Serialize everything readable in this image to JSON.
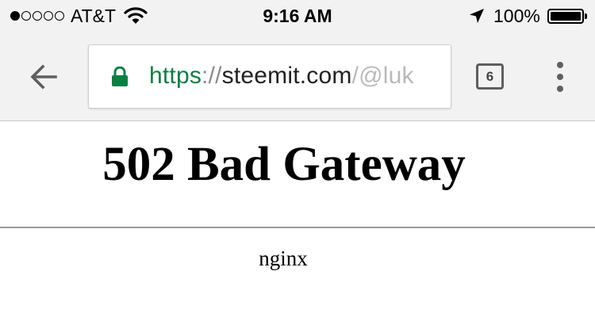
{
  "status_bar": {
    "signal_bars_filled": 1,
    "signal_bars_total": 5,
    "carrier": "AT&T",
    "time": "9:16 AM",
    "battery_percent": "100%",
    "battery_level": 1.0,
    "icons": [
      "wifi-icon",
      "location-arrow-icon",
      "battery-icon"
    ]
  },
  "browser": {
    "url": {
      "scheme": "https",
      "separator": "://",
      "host": "steemit.com",
      "path": "/@luk"
    },
    "tab_count": "6",
    "icons": [
      "back-arrow-icon",
      "lock-icon",
      "overflow-menu-icon"
    ],
    "colors": {
      "secure_green": "#0b8043",
      "toolbar_bg": "#f2f2f2"
    }
  },
  "page": {
    "heading": "502 Bad Gateway",
    "server": "nginx"
  }
}
